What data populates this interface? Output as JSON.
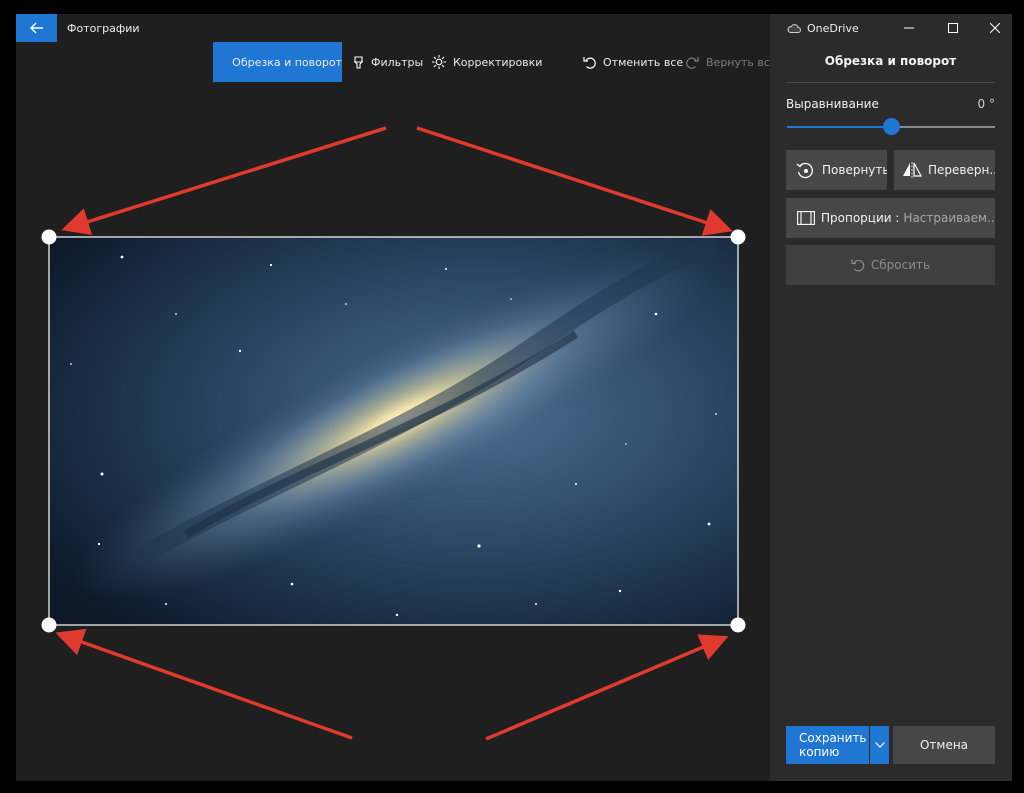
{
  "window": {
    "app_title": "Фотографии",
    "onedrive_label": "OneDrive"
  },
  "toolbar": {
    "crop_rotate": "Обрезка и поворот",
    "filters": "Фильтры",
    "adjustments": "Корректировки",
    "undo_all": "Отменить все",
    "redo_all": "Вернуть все"
  },
  "panel": {
    "heading": "Обрезка и поворот",
    "straighten_label": "Выравнивание",
    "straighten_value": "0 °",
    "straighten_level": 0.5,
    "rotate": "Повернуть",
    "flip": "Переверн...",
    "aspect_label": "Пропорции :",
    "aspect_value": "Настраиваем...",
    "reset": "Сбросить",
    "save_copy": "Сохранить копию",
    "cancel": "Отмена"
  },
  "colors": {
    "accent": "#1f77d3",
    "arrow": "#e03a2f",
    "panel_bg": "#2b2b2b",
    "canvas_bg": "#1f1f1f"
  },
  "icons": {
    "back": "arrow-left-icon",
    "crop": "crop-icon",
    "filters": "brush-icon",
    "adjust": "sun-icon",
    "undo": "undo-icon",
    "redo": "redo-icon",
    "rotate": "rotate-icon",
    "flip": "flip-icon",
    "aspect": "aspect-ratio-icon",
    "reset": "undo-icon",
    "onedrive": "cloud-icon"
  }
}
